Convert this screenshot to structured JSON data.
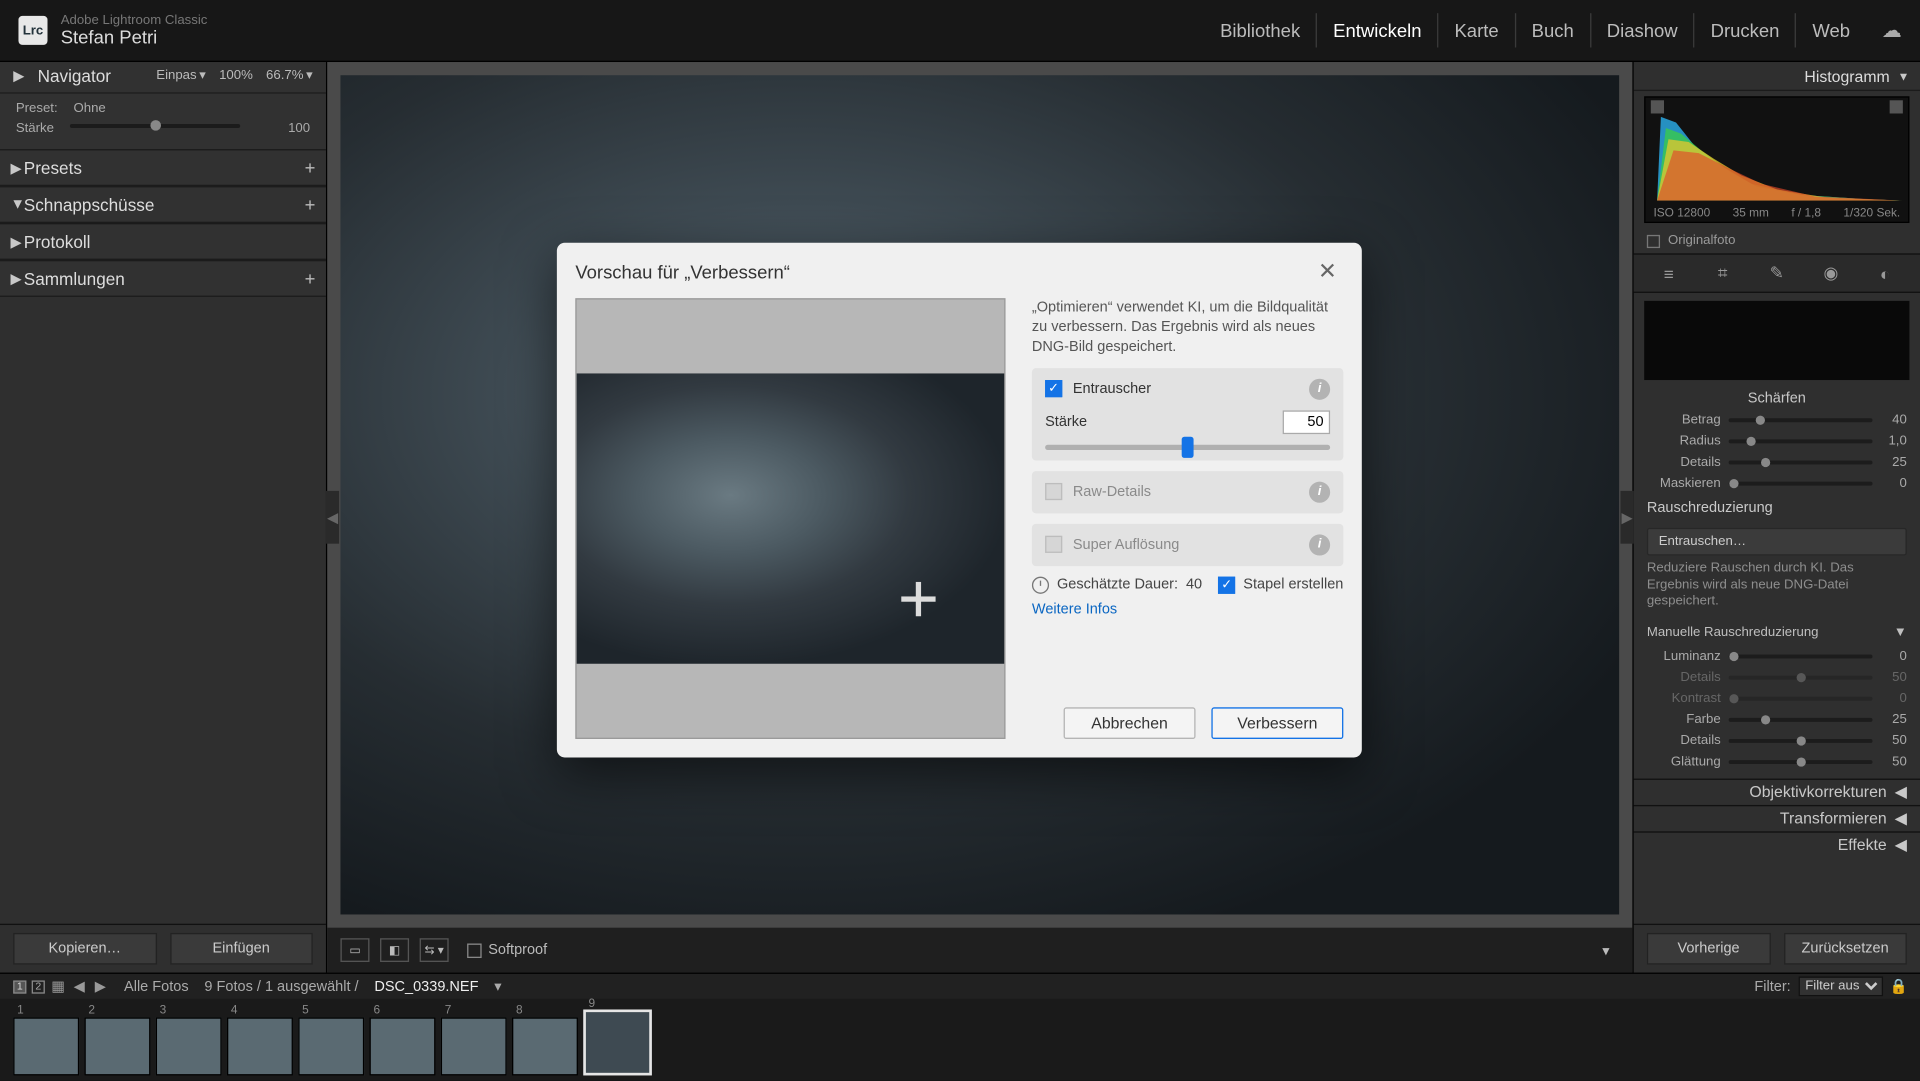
{
  "app": {
    "vendor": "Adobe Lightroom Classic",
    "badge": "Lrc",
    "user": "Stefan Petri"
  },
  "nav": {
    "items": [
      "Bibliothek",
      "Entwickeln",
      "Karte",
      "Buch",
      "Diashow",
      "Drucken",
      "Web"
    ],
    "active": 1
  },
  "left": {
    "navigator": {
      "title": "Navigator",
      "fit": "Einpas",
      "z100": "100%",
      "z66": "66.7%"
    },
    "preset_block": {
      "preset_label": "Preset:",
      "preset_value": "Ohne",
      "amount_label": "Stärke",
      "amount_value": "100"
    },
    "panels": [
      {
        "title": "Presets",
        "open": false,
        "plus": true
      },
      {
        "title": "Schnappschüsse",
        "open": true,
        "plus": true
      },
      {
        "title": "Protokoll",
        "open": false,
        "plus": false
      },
      {
        "title": "Sammlungen",
        "open": false,
        "plus": true
      }
    ],
    "copy": "Kopieren…",
    "paste": "Einfügen"
  },
  "right": {
    "histogram": {
      "title": "Histogramm",
      "iso": "ISO 12800",
      "focal": "35 mm",
      "aperture": "f / 1,8",
      "shutter": "1/320 Sek.",
      "original": "Originalfoto"
    },
    "sharpen": {
      "title": "Schärfen",
      "params": [
        {
          "label": "Betrag",
          "value": "40",
          "pos": 22
        },
        {
          "label": "Radius",
          "value": "1,0",
          "pos": 16
        },
        {
          "label": "Details",
          "value": "25",
          "pos": 26
        },
        {
          "label": "Maskieren",
          "value": "0",
          "pos": 4
        }
      ]
    },
    "noise": {
      "title": "Rauschreduzierung",
      "button": "Entrauschen…",
      "desc": "Reduziere Rauschen durch KI. Das Ergebnis wird als neue DNG-Datei gespeichert.",
      "manual": "Manuelle Rauschreduzierung",
      "params": [
        {
          "label": "Luminanz",
          "value": "0",
          "pos": 4,
          "dim": 0
        },
        {
          "label": "Details",
          "value": "50",
          "pos": 50,
          "dim": 1
        },
        {
          "label": "Kontrast",
          "value": "0",
          "pos": 4,
          "dim": 1
        },
        {
          "label": "Farbe",
          "value": "25",
          "pos": 26,
          "dim": 0
        },
        {
          "label": "Details",
          "value": "50",
          "pos": 50,
          "dim": 0
        },
        {
          "label": "Glättung",
          "value": "50",
          "pos": 50,
          "dim": 0
        }
      ]
    },
    "foot_panels": [
      "Objektivkorrekturen",
      "Transformieren",
      "Effekte"
    ],
    "prev": "Vorherige",
    "reset": "Zurücksetzen"
  },
  "bottom_toolbar": {
    "softproof": "Softproof"
  },
  "info": {
    "nums": [
      "1",
      "2"
    ],
    "scope": "Alle Fotos",
    "count": "9 Fotos / 1 ausgewählt /",
    "file": "DSC_0339.NEF",
    "filter_label": "Filter:",
    "filter_value": "Filter aus"
  },
  "thumbs": {
    "count": 9,
    "selected": 8
  },
  "modal": {
    "title": "Vorschau für „Verbessern“",
    "desc": "„Optimieren“ verwendet KI, um die Bildqualität zu verbessern. Das Ergebnis wird als neues DNG-Bild gespeichert.",
    "denoise": {
      "label": "Entrauscher",
      "strength_label": "Stärke",
      "value": "50",
      "pos": 50
    },
    "raw": "Raw-Details",
    "super": "Super Auflösung",
    "time_label": "Geschätzte Dauer:",
    "time_value": "40",
    "stack": "Stapel erstellen",
    "more": "Weitere Infos",
    "cancel": "Abbrechen",
    "enhance": "Verbessern"
  }
}
